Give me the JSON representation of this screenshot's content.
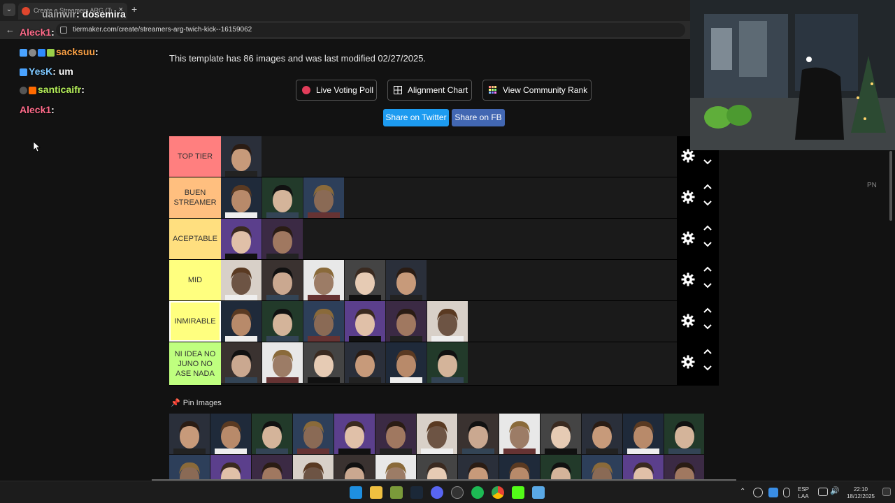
{
  "browser": {
    "tab_title": "Create a Streamers ARG (Twich...",
    "tab_close": "×",
    "new_tab": "+",
    "url": "tiermaker.com/create/streamers-arg-twich-kick--16159062"
  },
  "page": {
    "meta": "This template has 86 images and was last modified 02/27/2025.",
    "buttons": {
      "live_voting": "Live Voting Poll",
      "alignment": "Alignment Chart",
      "community_rank": "View Community Rank"
    },
    "share": {
      "twitter": "Share on Twitter",
      "fb": "Share on FB"
    },
    "pin_images": "Pin Images",
    "pn": "PN"
  },
  "tiers": [
    {
      "label": "TOP TIER",
      "color": "#ff7f7f",
      "count": 1
    },
    {
      "label": "BUEN STREAMER",
      "color": "#ffbf7f",
      "count": 3
    },
    {
      "label": "ACEPTABLE",
      "color": "#ffdf7f",
      "count": 2
    },
    {
      "label": "MID",
      "color": "#ffff7f",
      "count": 5
    },
    {
      "label": "INMIRABLE",
      "color": "#ffff7f",
      "count": 6
    },
    {
      "label": "NI IDEA NO JUNO NO ASE NADA",
      "color": "#bfff7f",
      "count": 6
    }
  ],
  "chat": [
    {
      "user": "uainwir",
      "msg": "dosemira",
      "color": "#b0b0b0"
    },
    {
      "user": "Aleck1",
      "msg": "",
      "color": "#ff6b8a"
    },
    {
      "user": "sacksuu",
      "msg": "",
      "color": "#ffa447"
    },
    {
      "user": "YesK",
      "msg": "um",
      "color": "#7ec8ff"
    },
    {
      "user": "santicaifr",
      "msg": "",
      "color": "#b6f05a"
    },
    {
      "user": "Aleck1",
      "msg": "",
      "color": "#ff6b8a"
    }
  ],
  "taskbar": {
    "lang_top": "ESP",
    "lang_bottom": "LAA",
    "time": "22:10",
    "date": "18/12/2025"
  },
  "colors": {
    "twitter": "#1d9bf0",
    "fb": "#4267b2",
    "live_dot": "#e23d5a"
  }
}
